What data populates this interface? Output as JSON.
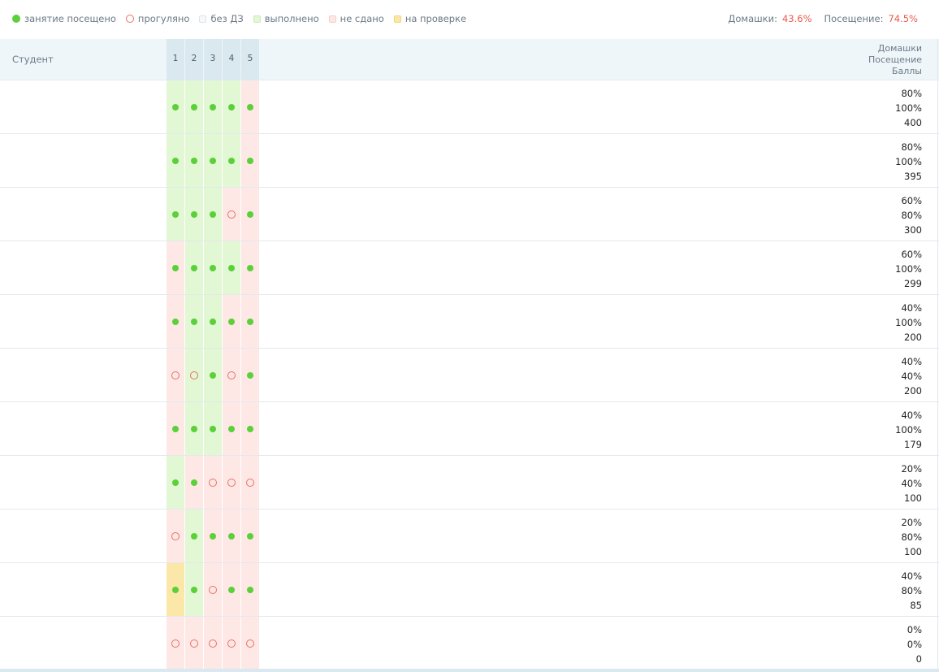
{
  "legend": {
    "items": [
      {
        "marker": "dot-full",
        "label": "занятие посещено"
      },
      {
        "marker": "dot-ring",
        "label": "прогуляно"
      },
      {
        "marker": "sq-none",
        "label": "без ДЗ"
      },
      {
        "marker": "sq-done",
        "label": "выполнено"
      },
      {
        "marker": "sq-fail",
        "label": "не сдано"
      },
      {
        "marker": "sq-check",
        "label": "на проверке"
      }
    ],
    "homework_label": "Домашки:",
    "homework_value": "43.6%",
    "attendance_label": "Посещение:",
    "attendance_value": "74.5%"
  },
  "colors": {
    "attended": "#5bd03a",
    "absent": "#ea6f66",
    "done": "#e2f7d3",
    "failed": "#fde8e6",
    "checking": "#fbe7a7",
    "accent_value": "#ea5a4c"
  },
  "table": {
    "student_header": "Студент",
    "lessons": [
      "1",
      "2",
      "3",
      "4",
      "5"
    ],
    "stats_headers": [
      "Домашки",
      "Посещение",
      "Баллы"
    ],
    "rows": [
      {
        "name": "",
        "cells": [
          [
            "done",
            1
          ],
          [
            "done",
            1
          ],
          [
            "done",
            1
          ],
          [
            "done",
            1
          ],
          [
            "fail",
            1
          ]
        ],
        "homework": "80%",
        "attendance": "100%",
        "score": "400"
      },
      {
        "name": "",
        "cells": [
          [
            "done",
            1
          ],
          [
            "done",
            1
          ],
          [
            "done",
            1
          ],
          [
            "done",
            1
          ],
          [
            "fail",
            1
          ]
        ],
        "homework": "80%",
        "attendance": "100%",
        "score": "395"
      },
      {
        "name": "",
        "cells": [
          [
            "done",
            1
          ],
          [
            "done",
            1
          ],
          [
            "done",
            1
          ],
          [
            "fail",
            0
          ],
          [
            "fail",
            1
          ]
        ],
        "homework": "60%",
        "attendance": "80%",
        "score": "300"
      },
      {
        "name": "",
        "cells": [
          [
            "fail",
            1
          ],
          [
            "done",
            1
          ],
          [
            "done",
            1
          ],
          [
            "done",
            1
          ],
          [
            "fail",
            1
          ]
        ],
        "homework": "60%",
        "attendance": "100%",
        "score": "299"
      },
      {
        "name": "",
        "cells": [
          [
            "fail",
            1
          ],
          [
            "done",
            1
          ],
          [
            "done",
            1
          ],
          [
            "fail",
            1
          ],
          [
            "fail",
            1
          ]
        ],
        "homework": "40%",
        "attendance": "100%",
        "score": "200"
      },
      {
        "name": "",
        "cells": [
          [
            "fail",
            0
          ],
          [
            "done",
            0
          ],
          [
            "done",
            1
          ],
          [
            "fail",
            0
          ],
          [
            "fail",
            1
          ]
        ],
        "homework": "40%",
        "attendance": "40%",
        "score": "200"
      },
      {
        "name": "",
        "cells": [
          [
            "fail",
            1
          ],
          [
            "done",
            1
          ],
          [
            "done",
            1
          ],
          [
            "fail",
            1
          ],
          [
            "fail",
            1
          ]
        ],
        "homework": "40%",
        "attendance": "100%",
        "score": "179"
      },
      {
        "name": "",
        "cells": [
          [
            "done",
            1
          ],
          [
            "fail",
            1
          ],
          [
            "fail",
            0
          ],
          [
            "fail",
            0
          ],
          [
            "fail",
            0
          ]
        ],
        "homework": "20%",
        "attendance": "40%",
        "score": "100"
      },
      {
        "name": "",
        "cells": [
          [
            "fail",
            0
          ],
          [
            "done",
            1
          ],
          [
            "fail",
            1
          ],
          [
            "fail",
            1
          ],
          [
            "fail",
            1
          ]
        ],
        "homework": "20%",
        "attendance": "80%",
        "score": "100"
      },
      {
        "name": "",
        "cells": [
          [
            "check",
            1
          ],
          [
            "done",
            1
          ],
          [
            "fail",
            0
          ],
          [
            "fail",
            1
          ],
          [
            "fail",
            1
          ]
        ],
        "homework": "40%",
        "attendance": "80%",
        "score": "85"
      },
      {
        "name": "",
        "cells": [
          [
            "fail",
            0
          ],
          [
            "fail",
            0
          ],
          [
            "fail",
            0
          ],
          [
            "fail",
            0
          ],
          [
            "fail",
            0
          ]
        ],
        "homework": "0%",
        "attendance": "0%",
        "score": "0"
      }
    ]
  }
}
